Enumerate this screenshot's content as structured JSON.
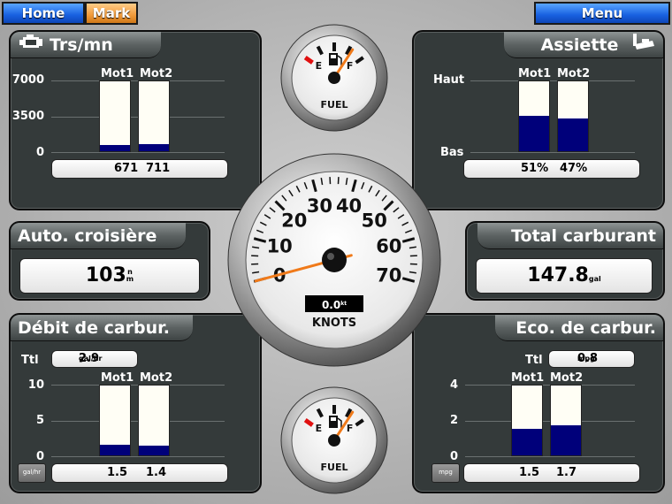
{
  "topbar": {
    "home_label": "Home",
    "mark_label": "Mark",
    "menu_label": "Menu"
  },
  "rpm": {
    "title": "Trs/mn",
    "icon": "engine-icon",
    "axis": [
      "7000",
      "3500",
      "0"
    ],
    "bars": [
      "Mot1",
      "Mot2"
    ],
    "values": [
      "671",
      "711"
    ],
    "fill": [
      0.095,
      0.101
    ]
  },
  "trim": {
    "title": "Assiette",
    "icon": "trim-boat-icon",
    "axis_top": "Haut",
    "axis_bottom": "Bas",
    "bars": [
      "Mot1",
      "Mot2"
    ],
    "values": [
      "51%",
      "47%"
    ],
    "fill": [
      0.51,
      0.47
    ]
  },
  "cruise": {
    "title": "Auto. croisière",
    "value": "103",
    "unit_top": "n",
    "unit_bottom": "m"
  },
  "total_fuel": {
    "title": "Total carburant",
    "value": "147.8",
    "unit": "gal"
  },
  "fuel_rate": {
    "title": "Débit de carbur.",
    "ttl_label": "Ttl",
    "ttl_value": "2.9",
    "ttl_unit": "gal/hr",
    "axis": [
      "10",
      "5",
      "0"
    ],
    "bars": [
      "Mot1",
      "Mot2"
    ],
    "values": [
      "1.5",
      "1.4"
    ],
    "fill": [
      0.15,
      0.14
    ],
    "unit_btn": "gal/hr"
  },
  "economy": {
    "title": "Eco. de carbur.",
    "ttl_label": "Ttl",
    "ttl_value": "0.8",
    "ttl_unit": "mpg",
    "axis": [
      "4",
      "2",
      "0"
    ],
    "bars": [
      "Mot1",
      "Mot2"
    ],
    "values": [
      "1.5",
      "1.7"
    ],
    "fill": [
      0.375,
      0.425
    ],
    "unit_btn": "mpg"
  },
  "fuel_gauge_top": {
    "label": "FUEL",
    "empty": "E",
    "full": "F",
    "level": 0.8
  },
  "fuel_gauge_bottom": {
    "label": "FUEL",
    "empty": "E",
    "full": "F",
    "level": 0.8
  },
  "speedo": {
    "ticks": [
      "0",
      "10",
      "20",
      "30",
      "40",
      "50",
      "60",
      "70"
    ],
    "unit": "KNOTS",
    "value": "0.0",
    "value_unit": "kt",
    "max": 70,
    "speed": 0
  }
}
